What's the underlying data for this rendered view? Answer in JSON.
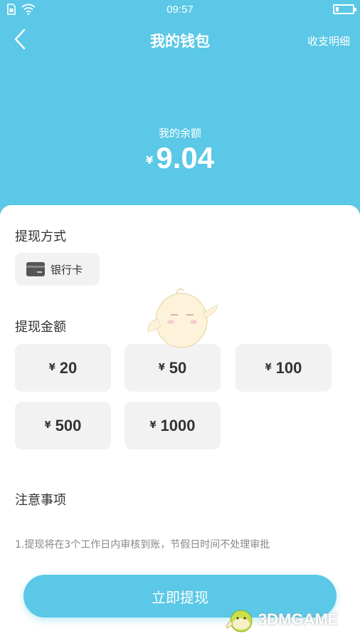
{
  "status_bar": {
    "time": "09:57"
  },
  "nav": {
    "title": "我的钱包",
    "detail_link": "收支明细"
  },
  "balance": {
    "label": "我的余额",
    "currency": "¥",
    "amount": "9.04"
  },
  "withdraw_method": {
    "title": "提现方式",
    "option_label": "银行卡"
  },
  "withdraw_amount": {
    "title": "提现金额",
    "currency": "¥",
    "options": [
      "20",
      "50",
      "100",
      "500",
      "1000"
    ]
  },
  "notes": {
    "title": "注意事项",
    "items": [
      "1.提现将在3个工作日内审核到账，节假日时间不处理审批"
    ]
  },
  "submit_label": "立即提现",
  "watermark": {
    "text": "3DMGAME"
  },
  "colors": {
    "primary": "#5ac8e6",
    "chip_bg": "#f2f2f2"
  }
}
